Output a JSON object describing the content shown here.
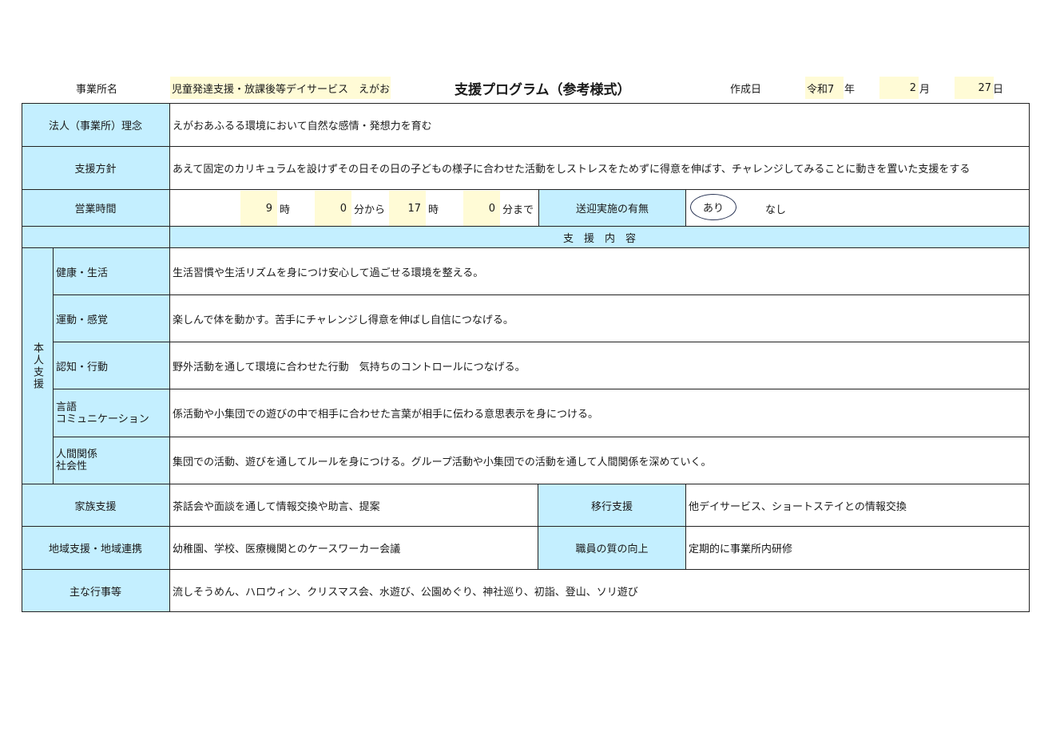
{
  "header": {
    "office_label": "事業所名",
    "office_name": "児童発達支援・放課後等デイサービス　えがお",
    "title": "支援プログラム（参考様式）",
    "created_label": "作成日",
    "era": "令和7",
    "year_unit": "年",
    "month": "2",
    "month_unit": "月",
    "day": "27",
    "day_unit": "日"
  },
  "philosophy": {
    "label": "法人（事業所）理念",
    "value": "えがおあふるる環境において自然な感情・発想力を育む"
  },
  "policy": {
    "label": "支援方針",
    "value": "あえて固定のカリキュラムを設けずその日その日の子どもの様子に合わせた活動をしストレスをためずに得意を伸ばす、チャレンジしてみることに動きを置いた支援をする"
  },
  "hours": {
    "label": "営業時間",
    "start_hour": "9",
    "hour_unit": "時",
    "start_min": "0",
    "start_min_unit": "分から",
    "end_hour": "17",
    "end_hour_unit": "時",
    "end_min": "0",
    "end_min_unit": "分まで",
    "transport_label": "送迎実施の有無",
    "transport_yes": "あり",
    "transport_no": "なし"
  },
  "support_header": "支　援　内　容",
  "personal": {
    "label": "本人支援",
    "rows": [
      {
        "label": "健康・生活",
        "value": "生活習慣や生活リズムを身につけ安心して過ごせる環境を整える。"
      },
      {
        "label": "運動・感覚",
        "value": "楽しんで体を動かす。苦手にチャレンジし得意を伸ばし自信につなげる。"
      },
      {
        "label": "認知・行動",
        "value": "野外活動を通して環境に合わせた行動　気持ちのコントロールにつなげる。"
      },
      {
        "label": "言語\nコミュニケーション",
        "value": "係活動や小集団での遊びの中で相手に合わせた言葉が相手に伝わる意思表示を身につける。"
      },
      {
        "label": "人間関係\n社会性",
        "value": "集団での活動、遊びを通してルールを身につける。グループ活動や小集団での活動を通して人間関係を深めていく。"
      }
    ]
  },
  "family": {
    "label": "家族支援",
    "value": "茶話会や面談を通して情報交換や助言、提案"
  },
  "transition": {
    "label": "移行支援",
    "value": "他デイサービス、ショートステイとの情報交換"
  },
  "community": {
    "label": "地域支援・地域連携",
    "value": "幼稚園、学校、医療機関とのケースワーカー会議"
  },
  "staff": {
    "label": "職員の質の向上",
    "value": "定期的に事業所内研修"
  },
  "events": {
    "label": "主な行事等",
    "value": "流しそうめん、ハロウィン、クリスマス会、水遊び、公園めぐり、神社巡り、初詣、登山、ソリ遊び"
  }
}
